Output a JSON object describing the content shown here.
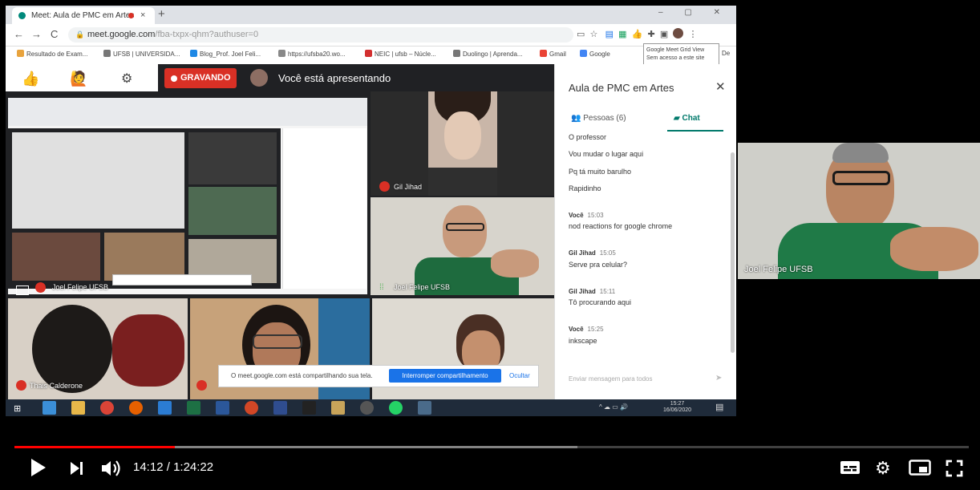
{
  "browser": {
    "tab_title": "Meet: Aula de PMC em Artes",
    "tab_close": "×",
    "new_tab": "+",
    "window_controls": "–  ▢  ✕",
    "back": "←",
    "forward": "→",
    "reload": "C",
    "url_host": "meet.google.com",
    "url_path": "/fba-txpx-qhm?authuser=0",
    "bookmarks": [
      "Resultado de Exam...",
      "UFSB | UNIVERSIDA...",
      "Blog_Prof. Joel Feli...",
      "https://ufsba20.wo...",
      "NEIC | ufsb – Núcle...",
      "Duolingo | Aprenda...",
      "Gmail",
      "Google",
      "De"
    ],
    "tooltip": "Google Meet Grid View\nSem acesso a este site"
  },
  "meet": {
    "recording_label": "GRAVANDO",
    "presenting_text": "Você está apresentando",
    "participants": [
      {
        "name": "Gil Jihad",
        "mic": "off"
      },
      {
        "name": "Joel Felipe UFSB",
        "mic": "on"
      },
      {
        "name": "Joel Felipe UFSB",
        "mic": "off"
      },
      {
        "name": "Thais Calderone",
        "mic": "off"
      }
    ],
    "share_banner": {
      "text": "O meet.google.com está compartilhando sua tela.",
      "stop_button": "Interromper compartilhamento",
      "hide_button": "Ocultar"
    }
  },
  "chat": {
    "title": "Aula de PMC em Artes",
    "close": "✕",
    "tab_people": "Pessoas (6)",
    "tab_chat": "Chat",
    "loose_messages": [
      "O professor",
      "Vou mudar o lugar aqui",
      "Pq tá muito barulho",
      "Rapidinho"
    ],
    "groups": [
      {
        "sender": "Você",
        "time": "15:03",
        "messages": [
          "nod reactions for google chrome"
        ]
      },
      {
        "sender": "Gil Jihad",
        "time": "15:05",
        "messages": [
          "Serve pra celular?"
        ]
      },
      {
        "sender": "Gil Jihad",
        "time": "15:11",
        "messages": [
          "Tô procurando aqui"
        ]
      },
      {
        "sender": "Você",
        "time": "15:25",
        "messages": [
          "inkscape"
        ]
      }
    ],
    "input_placeholder": "Enviar mensagem para todos",
    "send": "➤"
  },
  "taskbar": {
    "time": "15:27",
    "date": "16/06/2020"
  },
  "webcam": {
    "label": "Joel Felipe UFSB"
  },
  "player": {
    "current_time": "14:12",
    "duration": "1:24:22",
    "separator": " / ",
    "progress_fraction": 0.168,
    "buffered_fraction": 0.59,
    "colors": {
      "progress": "#ff0000"
    }
  }
}
